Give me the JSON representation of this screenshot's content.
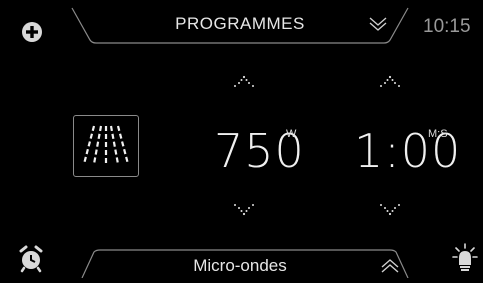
{
  "header": {
    "title": "PROGRAMMES",
    "clock": "10:15"
  },
  "power": {
    "value": "750",
    "unit": "W"
  },
  "duration": {
    "value": "1:00",
    "unit": "M:S"
  },
  "footer": {
    "mode_label": "Micro-ondes"
  },
  "icons": {
    "add": "plus-icon",
    "menu_toggle": "double-chevron-down-icon",
    "mode": "microwave-waves-icon",
    "alarm": "alarm-clock-icon",
    "lamp": "lamp-icon",
    "bottom_toggle": "double-chevron-up-icon"
  },
  "colors": {
    "background": "#000000",
    "text": "#e8e8e8",
    "clock": "#9a9a9a",
    "tab_outline": "#8a8a8a"
  }
}
